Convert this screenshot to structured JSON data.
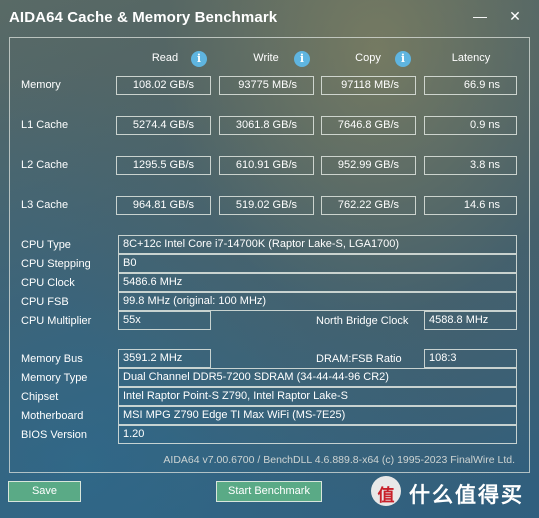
{
  "window": {
    "title": "AIDA64 Cache & Memory Benchmark",
    "minimize_glyph": "—",
    "close_glyph": "✕"
  },
  "columns": {
    "read": "Read",
    "write": "Write",
    "copy": "Copy",
    "latency": "Latency",
    "info_glyph": "i"
  },
  "bench": [
    {
      "label": "Memory",
      "read": "108.02 GB/s",
      "write": "93775 MB/s",
      "copy": "97118 MB/s",
      "latency": "66.9 ns"
    },
    {
      "label": "L1 Cache",
      "read": "5274.4 GB/s",
      "write": "3061.8 GB/s",
      "copy": "7646.8 GB/s",
      "latency": "0.9 ns"
    },
    {
      "label": "L2 Cache",
      "read": "1295.5 GB/s",
      "write": "610.91 GB/s",
      "copy": "952.99 GB/s",
      "latency": "3.8 ns"
    },
    {
      "label": "L3 Cache",
      "read": "964.81 GB/s",
      "write": "519.02 GB/s",
      "copy": "762.22 GB/s",
      "latency": "14.6 ns"
    }
  ],
  "cpu": {
    "type_label": "CPU Type",
    "type_value": "8C+12c Intel Core i7-14700K  (Raptor Lake-S, LGA1700)",
    "stepping_label": "CPU Stepping",
    "stepping_value": "B0",
    "clock_label": "CPU Clock",
    "clock_value": "5486.6 MHz",
    "fsb_label": "CPU FSB",
    "fsb_value": "99.8 MHz  (original: 100 MHz)",
    "multiplier_label": "CPU Multiplier",
    "multiplier_value": "55x",
    "nb_clock_label": "North Bridge Clock",
    "nb_clock_value": "4588.8 MHz"
  },
  "memory": {
    "bus_label": "Memory Bus",
    "bus_value": "3591.2 MHz",
    "ratio_label": "DRAM:FSB Ratio",
    "ratio_value": "108:3",
    "type_label": "Memory Type",
    "type_value": "Dual Channel DDR5-7200 SDRAM  (34-44-44-96 CR2)",
    "chipset_label": "Chipset",
    "chipset_value": "Intel Raptor Point-S Z790, Intel Raptor Lake-S",
    "motherboard_label": "Motherboard",
    "motherboard_value": "MSI MPG Z790 Edge TI Max WiFi (MS-7E25)",
    "bios_label": "BIOS Version",
    "bios_value": "1.20"
  },
  "footer": "AIDA64 v7.00.6700 / BenchDLL 4.6.889.8-x64  (c) 1995-2023 FinalWire Ltd.",
  "buttons": {
    "save": "Save",
    "start": "Start Benchmark"
  },
  "watermark": {
    "text": "什么值得买"
  },
  "colors": {
    "button_bg": "#5aaa86",
    "info_icon": "#5fb5e0",
    "field_border": "#e1e6e1"
  }
}
